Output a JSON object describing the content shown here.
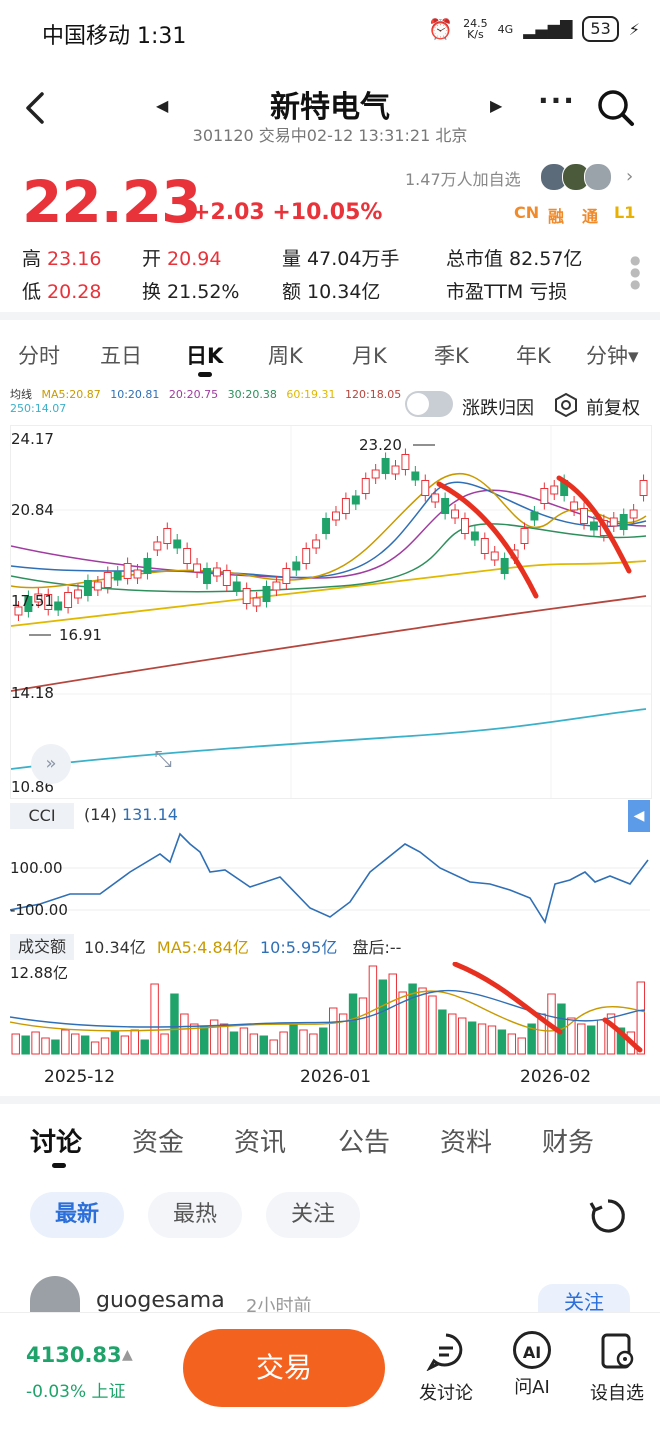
{
  "status_bar": {
    "carrier_time": "中国移动 1:31",
    "net_speed_value": "24.5",
    "net_speed_unit": "K/s",
    "network": "4G",
    "battery": "53"
  },
  "header": {
    "title": "新特电气",
    "subtitle": "301120 交易中02-12 13:31:21 北京"
  },
  "quote": {
    "price": "22.23",
    "change": "+2.03 +10.05%",
    "follow_count": "1.47万人加自选",
    "badges": [
      "CN",
      "融",
      "通",
      "L1"
    ],
    "stats": [
      {
        "label": "高",
        "value": "23.16"
      },
      {
        "label": "开",
        "value": "20.94"
      },
      {
        "label": "量",
        "value": "47.04万手"
      },
      {
        "label": "总市值",
        "value": "82.57亿"
      },
      {
        "label": "低",
        "value": "20.28"
      },
      {
        "label": "换",
        "value": "21.52%"
      },
      {
        "label": "额",
        "value": "10.34亿"
      },
      {
        "label": "市盈TTM",
        "value": "亏损"
      }
    ]
  },
  "chart_tabs": [
    "分时",
    "五日",
    "日K",
    "周K",
    "月K",
    "季K",
    "年K",
    "分钟▾"
  ],
  "ma_legend": {
    "title": "均线",
    "items": [
      {
        "text": "MA5:20.87",
        "color": "#c99a00"
      },
      {
        "text": "10:20.81",
        "color": "#2f6fb5"
      },
      {
        "text": "20:20.75",
        "color": "#a03ca0"
      },
      {
        "text": "30:20.38",
        "color": "#2e8f5c"
      },
      {
        "text": "60:19.31",
        "color": "#e0b800"
      },
      {
        "text": "120:18.05",
        "color": "#b5463e"
      },
      {
        "text": "250:14.07",
        "color": "#3bb0c9"
      }
    ],
    "toggle_label": "涨跌归因",
    "restore_label": "前复权"
  },
  "kline": {
    "y_ticks": [
      "24.17",
      "20.84",
      "17.51",
      "14.18",
      "10.86"
    ],
    "high_mark": "23.20",
    "low_mark": "16.91"
  },
  "cci": {
    "label": "CCI",
    "param": "(14)",
    "value": "131.14",
    "ticks": [
      "100.00",
      "-100.00"
    ]
  },
  "volume": {
    "label": "成交额",
    "value": "10.34亿",
    "ma5": "MA5:4.84亿",
    "ma10": "10:5.95亿",
    "after": "盘后:--",
    "tick": "12.88亿"
  },
  "x_dates": [
    "2025-12",
    "2026-01",
    "2026-02"
  ],
  "content_tabs": [
    "讨论",
    "资金",
    "资讯",
    "公告",
    "资料",
    "财务"
  ],
  "filters": [
    "最新",
    "最热",
    "关注"
  ],
  "post": {
    "user": "guogesama",
    "time": "2小时前",
    "follow": "关注"
  },
  "index": {
    "value": "4130.83",
    "change": "-0.03% 上证"
  },
  "bottom": {
    "trade": "交易",
    "discuss": "发讨论",
    "ai": "问AI",
    "watch": "设自选",
    "ai_glyph": "AI"
  },
  "colors": {
    "up": "#e8333a",
    "down": "#1fa36a",
    "accent": "#2d6fd8",
    "trade": "#f4621f"
  },
  "icons": [
    "back-icon",
    "prev-icon",
    "next-icon",
    "more-icon",
    "search-icon",
    "chevron-right-icon",
    "expand-icon",
    "resize-icon",
    "refresh-icon",
    "discuss-icon",
    "ai-icon",
    "watchlist-icon"
  ]
}
